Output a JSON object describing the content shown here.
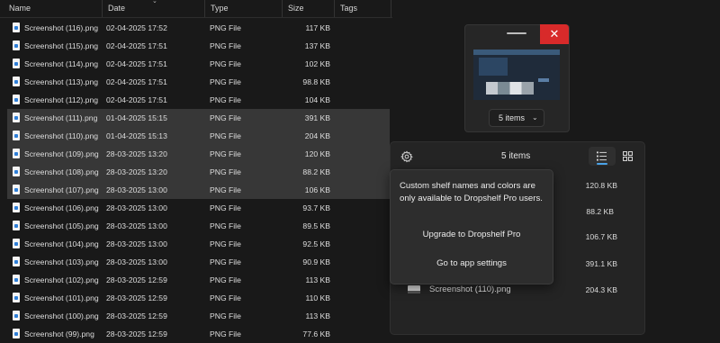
{
  "columns": {
    "name": "Name",
    "date": "Date",
    "type": "Type",
    "size": "Size",
    "tags": "Tags"
  },
  "files": [
    {
      "name": "Screenshot (116).png",
      "date": "02-04-2025 17:52",
      "type": "PNG File",
      "size": "117 KB",
      "selected": false
    },
    {
      "name": "Screenshot (115).png",
      "date": "02-04-2025 17:51",
      "type": "PNG File",
      "size": "137 KB",
      "selected": false
    },
    {
      "name": "Screenshot (114).png",
      "date": "02-04-2025 17:51",
      "type": "PNG File",
      "size": "102 KB",
      "selected": false
    },
    {
      "name": "Screenshot (113).png",
      "date": "02-04-2025 17:51",
      "type": "PNG File",
      "size": "98.8 KB",
      "selected": false
    },
    {
      "name": "Screenshot (112).png",
      "date": "02-04-2025 17:51",
      "type": "PNG File",
      "size": "104 KB",
      "selected": false
    },
    {
      "name": "Screenshot (111).png",
      "date": "01-04-2025 15:15",
      "type": "PNG File",
      "size": "391 KB",
      "selected": true
    },
    {
      "name": "Screenshot (110).png",
      "date": "01-04-2025 15:13",
      "type": "PNG File",
      "size": "204 KB",
      "selected": true
    },
    {
      "name": "Screenshot (109).png",
      "date": "28-03-2025 13:20",
      "type": "PNG File",
      "size": "120 KB",
      "selected": true
    },
    {
      "name": "Screenshot (108).png",
      "date": "28-03-2025 13:20",
      "type": "PNG File",
      "size": "88.2 KB",
      "selected": true
    },
    {
      "name": "Screenshot (107).png",
      "date": "28-03-2025 13:00",
      "type": "PNG File",
      "size": "106 KB",
      "selected": true
    },
    {
      "name": "Screenshot (106).png",
      "date": "28-03-2025 13:00",
      "type": "PNG File",
      "size": "93.7 KB",
      "selected": false
    },
    {
      "name": "Screenshot (105).png",
      "date": "28-03-2025 13:00",
      "type": "PNG File",
      "size": "89.5 KB",
      "selected": false
    },
    {
      "name": "Screenshot (104).png",
      "date": "28-03-2025 13:00",
      "type": "PNG File",
      "size": "92.5 KB",
      "selected": false
    },
    {
      "name": "Screenshot (103).png",
      "date": "28-03-2025 13:00",
      "type": "PNG File",
      "size": "90.9 KB",
      "selected": false
    },
    {
      "name": "Screenshot (102).png",
      "date": "28-03-2025 12:59",
      "type": "PNG File",
      "size": "113 KB",
      "selected": false
    },
    {
      "name": "Screenshot (101).png",
      "date": "28-03-2025 12:59",
      "type": "PNG File",
      "size": "110 KB",
      "selected": false
    },
    {
      "name": "Screenshot (100).png",
      "date": "28-03-2025 12:59",
      "type": "PNG File",
      "size": "113 KB",
      "selected": false
    },
    {
      "name": "Screenshot (99).png",
      "date": "28-03-2025 12:59",
      "type": "PNG File",
      "size": "77.6 KB",
      "selected": false
    }
  ],
  "thumbnail": {
    "items_label": "5 items",
    "close_glyph": "✕"
  },
  "shelf": {
    "count_label": "5 items",
    "sizes": [
      "120.8 KB",
      "88.2 KB",
      "106.7 KB",
      "391.1 KB",
      "204.3 KB"
    ],
    "visible_item_name": "Screenshot (110).png"
  },
  "pro_popup": {
    "message": "Custom shelf names and colors are only available to Dropshelf Pro users.",
    "upgrade_label": "Upgrade to Dropshelf Pro",
    "settings_label": "Go to app settings"
  },
  "colors": {
    "background": "#191919",
    "close_button": "#d82a2a",
    "accent": "#4aa3e8",
    "selected_row": "#373737"
  },
  "icons": [
    "file-png-icon",
    "close-icon",
    "chevron-down-icon",
    "gear-icon",
    "list-view-icon",
    "grid-view-icon",
    "sort-arrow-icon"
  ]
}
